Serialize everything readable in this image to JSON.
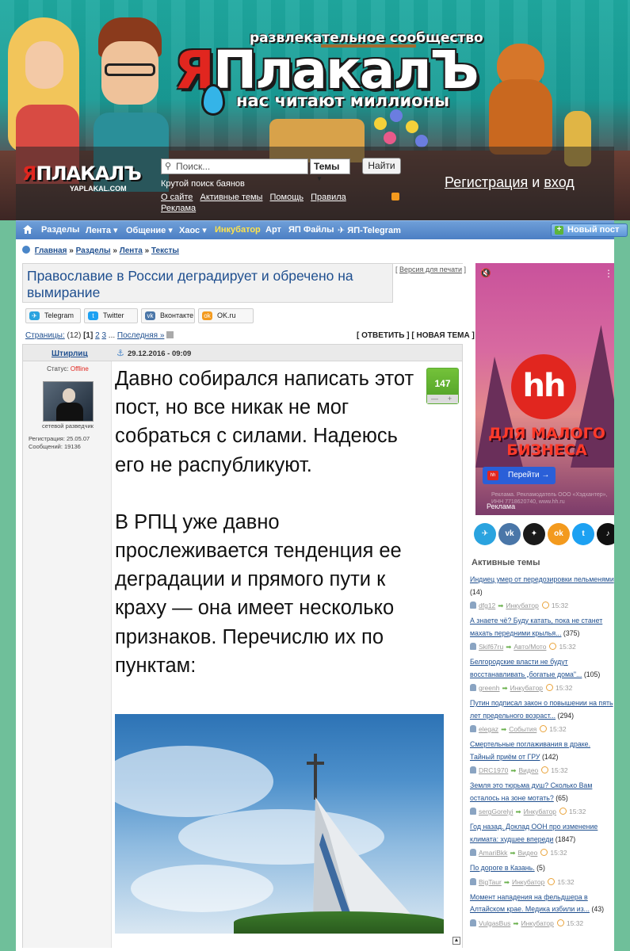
{
  "header": {
    "brand_sub": "развлекательное сообщество",
    "brand_title_ya": "Я",
    "brand_title_rest": "ПлакалЪ",
    "brand_tag": "нас читают миллионы",
    "small_logo_ya": "Я",
    "small_logo_rest": "ПЛАКАЛЪ",
    "small_logo_url": "YAPLAKAL.COM",
    "search_placeholder": "Поиск...",
    "themes_select": "Темы",
    "find_button": "Найти",
    "search_hint": "Крутой поиск баянов",
    "links": [
      "О сайте",
      "Активные темы",
      "Помощь",
      "Правила",
      "Реклама"
    ],
    "auth_register": "Регистрация",
    "auth_and": "и",
    "auth_login": "вход"
  },
  "nav": {
    "items": [
      "Разделы",
      "Лента ▾",
      "Общение ▾",
      "Хаос ▾",
      "Инкубатор",
      "Арт",
      "ЯП Файлы",
      "ЯП-Telegram"
    ],
    "new_post": "Новый пост"
  },
  "breadcrumb": {
    "items": [
      "Главная",
      "Разделы",
      "Лента",
      "Тексты"
    ],
    "sep": "»"
  },
  "topic": {
    "title": "Православие в России деградирует и обречено на вымирание",
    "print_version": "Версия для печати"
  },
  "share": [
    "Telegram",
    "Twitter",
    "Вконтакте",
    "OK.ru"
  ],
  "pager": {
    "label": "Страницы:",
    "count": "(12)",
    "current": "[1]",
    "p2": "2",
    "p3": "3",
    "ellipsis": "...",
    "last": "Последняя »",
    "reply": "[ ОТВЕТИТЬ ]",
    "new_topic": "[ НОВАЯ ТЕМА ]"
  },
  "post": {
    "author": "Штирлиц",
    "date": "29.12.2016 - 09:09",
    "status_label": "Статус:",
    "status_value": "Offline",
    "rank": "сетевой разведчик",
    "registration": "Регистрация: 25.05.07",
    "messages": "Сообщений: 19136",
    "rating": "147",
    "rating_minus": "—",
    "rating_plus": "+",
    "paragraph1": "Давно собирался написать этот пост, но все никак не мог собраться с силами. Надеюсь его не распубликуют.",
    "paragraph2": "В РПЦ уже давно прослеживается тенденция ее деградации и прямого пути к краху — она имеет несколько признаков. Перечислю их по пунктам:"
  },
  "ad": {
    "logo": "hh",
    "slogan": "ДЛЯ МАЛОГО БИЗНЕСА",
    "button": "Перейти →",
    "small_print": "Реклама. Рекламодатель ООО «Хэдхантер», ИНН 7718620740, www.hh.ru",
    "label": "Реклама"
  },
  "socials": [
    {
      "name": "telegram-icon",
      "glyph": "✈",
      "color": "#2aa3df"
    },
    {
      "name": "vk-icon",
      "glyph": "vk",
      "color": "#4a76a8"
    },
    {
      "name": "compass-icon",
      "glyph": "✦",
      "color": "#1a1a1a"
    },
    {
      "name": "ok-icon",
      "glyph": "ok",
      "color": "#f39a1e"
    },
    {
      "name": "twitter-icon",
      "glyph": "t",
      "color": "#1da1f2"
    },
    {
      "name": "tiktok-icon",
      "glyph": "♪",
      "color": "#111111"
    }
  ],
  "active_topics": {
    "title": "Активные темы",
    "items": [
      {
        "title": "Индиец умер от передозировки пельменями",
        "count": "(14)",
        "user": "dfg12",
        "section": "Инкубатор",
        "time": "15:32"
      },
      {
        "title": "А знаете чё? Буду катать, пока не станет махать передними крылья...",
        "count": "(375)",
        "user": "Skif67ru",
        "section": "Авто/Мото",
        "time": "15:32"
      },
      {
        "title": "Белгородские власти не будут восстанавливать „богатые дома\"...",
        "count": "(105)",
        "user": "greenh",
        "section": "Инкубатор",
        "time": "15:32"
      },
      {
        "title": "Путин подписал закон о повышении на пять лет предельного возраст...",
        "count": "(294)",
        "user": "elegaz",
        "section": "События",
        "time": "15:32"
      },
      {
        "title": "Смертельные поглаживания в драке. Тайный приём от ГРУ",
        "count": "(142)",
        "user": "DRC1970",
        "section": "Видео",
        "time": "15:32"
      },
      {
        "title": "Земля это тюрьма душ? Сколько Вам осталось на зоне мотать?",
        "count": "(65)",
        "user": "sergGorelyi",
        "section": "Инкубатор",
        "time": "15:32"
      },
      {
        "title": "Год назад. Доклад ООН про изменение климата: худшее впереди",
        "count": "(1847)",
        "user": "AmariBkk",
        "section": "Видео",
        "time": "15:32"
      },
      {
        "title": "По дороге в Казань.",
        "count": "(5)",
        "user": "BigTaur",
        "section": "Инкубатор",
        "time": "15:32"
      },
      {
        "title": "Момент нападения на фельдшера в Алтайском крае. Медика избили из...",
        "count": "(43)",
        "user": "VulgasBus",
        "section": "Инкубатор",
        "time": "15:32"
      }
    ]
  }
}
